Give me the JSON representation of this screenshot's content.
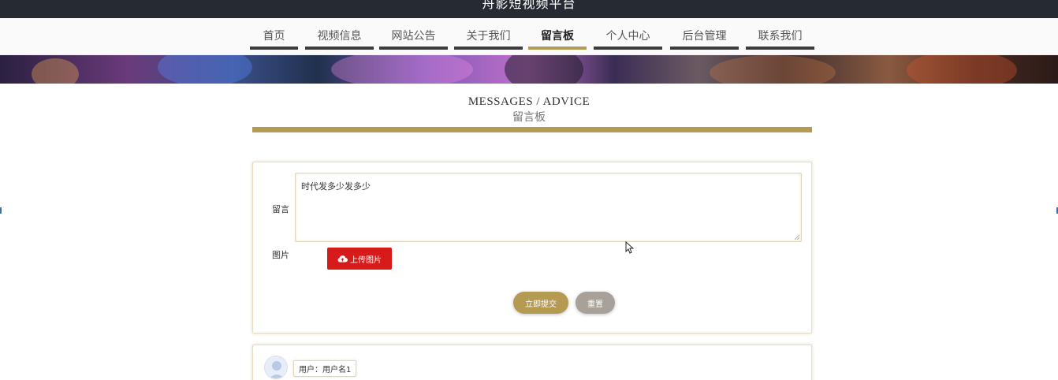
{
  "site": {
    "title": "舟影短视频平台"
  },
  "nav": {
    "items": [
      {
        "label": "首页"
      },
      {
        "label": "视频信息"
      },
      {
        "label": "网站公告"
      },
      {
        "label": "关于我们"
      },
      {
        "label": "留言板"
      },
      {
        "label": "个人中心"
      },
      {
        "label": "后台管理"
      },
      {
        "label": "联系我们"
      }
    ],
    "active": "留言板"
  },
  "section": {
    "title_en": "MESSAGES / ADVICE",
    "title_zh": "留言板"
  },
  "form": {
    "message_label": "留言",
    "message_value": "时代发多少发多少",
    "image_label": "图片",
    "upload_label": "上传图片",
    "submit_label": "立即提交",
    "reset_label": "重置"
  },
  "comments": [
    {
      "user": "用户：用户名1"
    }
  ],
  "colors": {
    "accent": "#b59a52",
    "upload": "#d71b1b",
    "reset": "#a8a199",
    "topbar": "#262b33"
  },
  "icons": {
    "upload": "cloud-upload-icon",
    "avatar": "user-avatar-icon"
  }
}
